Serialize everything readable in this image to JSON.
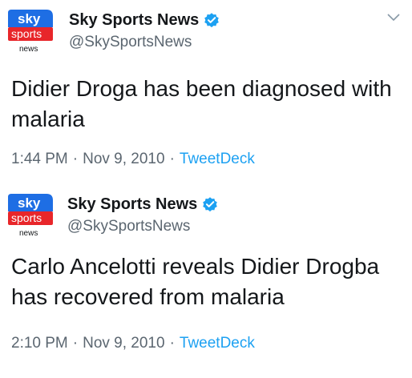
{
  "colors": {
    "sky_blue": "#1e6ee4",
    "sky_red": "#e8262a",
    "verified_blue": "#1da1f2",
    "link_blue": "#1da1f2",
    "text_primary": "#14171a",
    "text_secondary": "#5b6670"
  },
  "icons": {
    "logo": "sky-sports-news-logo",
    "verified": "verified-badge-icon",
    "menu": "chevron-down-icon"
  },
  "tweets": [
    {
      "logo": {
        "line1": "sky",
        "line2": "sports",
        "line3": "news"
      },
      "display_name": "Sky Sports News",
      "handle": "@SkySportsNews",
      "text": "Didier Droga has been diagnosed with malaria",
      "time": "1:44 PM",
      "date": "Nov 9, 2010",
      "separator": "·",
      "source": "TweetDeck"
    },
    {
      "logo": {
        "line1": "sky",
        "line2": "sports",
        "line3": "news"
      },
      "display_name": "Sky Sports News",
      "handle": "@SkySportsNews",
      "text": "Carlo Ancelotti reveals Didier Drogba has recovered from malaria",
      "time": "2:10 PM",
      "date": "Nov 9, 2010",
      "separator": "·",
      "source": "TweetDeck"
    }
  ]
}
